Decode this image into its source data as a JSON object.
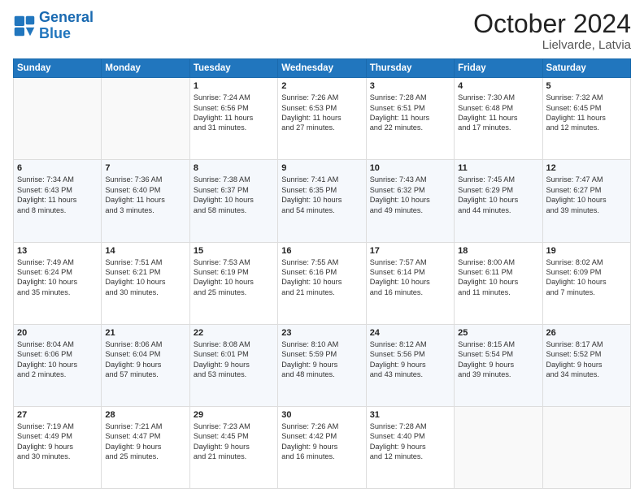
{
  "header": {
    "logo_general": "General",
    "logo_blue": "Blue",
    "month": "October 2024",
    "location": "Lielvarde, Latvia"
  },
  "days_of_week": [
    "Sunday",
    "Monday",
    "Tuesday",
    "Wednesday",
    "Thursday",
    "Friday",
    "Saturday"
  ],
  "weeks": [
    [
      {
        "day": "",
        "lines": []
      },
      {
        "day": "",
        "lines": []
      },
      {
        "day": "1",
        "lines": [
          "Sunrise: 7:24 AM",
          "Sunset: 6:56 PM",
          "Daylight: 11 hours",
          "and 31 minutes."
        ]
      },
      {
        "day": "2",
        "lines": [
          "Sunrise: 7:26 AM",
          "Sunset: 6:53 PM",
          "Daylight: 11 hours",
          "and 27 minutes."
        ]
      },
      {
        "day": "3",
        "lines": [
          "Sunrise: 7:28 AM",
          "Sunset: 6:51 PM",
          "Daylight: 11 hours",
          "and 22 minutes."
        ]
      },
      {
        "day": "4",
        "lines": [
          "Sunrise: 7:30 AM",
          "Sunset: 6:48 PM",
          "Daylight: 11 hours",
          "and 17 minutes."
        ]
      },
      {
        "day": "5",
        "lines": [
          "Sunrise: 7:32 AM",
          "Sunset: 6:45 PM",
          "Daylight: 11 hours",
          "and 12 minutes."
        ]
      }
    ],
    [
      {
        "day": "6",
        "lines": [
          "Sunrise: 7:34 AM",
          "Sunset: 6:43 PM",
          "Daylight: 11 hours",
          "and 8 minutes."
        ]
      },
      {
        "day": "7",
        "lines": [
          "Sunrise: 7:36 AM",
          "Sunset: 6:40 PM",
          "Daylight: 11 hours",
          "and 3 minutes."
        ]
      },
      {
        "day": "8",
        "lines": [
          "Sunrise: 7:38 AM",
          "Sunset: 6:37 PM",
          "Daylight: 10 hours",
          "and 58 minutes."
        ]
      },
      {
        "day": "9",
        "lines": [
          "Sunrise: 7:41 AM",
          "Sunset: 6:35 PM",
          "Daylight: 10 hours",
          "and 54 minutes."
        ]
      },
      {
        "day": "10",
        "lines": [
          "Sunrise: 7:43 AM",
          "Sunset: 6:32 PM",
          "Daylight: 10 hours",
          "and 49 minutes."
        ]
      },
      {
        "day": "11",
        "lines": [
          "Sunrise: 7:45 AM",
          "Sunset: 6:29 PM",
          "Daylight: 10 hours",
          "and 44 minutes."
        ]
      },
      {
        "day": "12",
        "lines": [
          "Sunrise: 7:47 AM",
          "Sunset: 6:27 PM",
          "Daylight: 10 hours",
          "and 39 minutes."
        ]
      }
    ],
    [
      {
        "day": "13",
        "lines": [
          "Sunrise: 7:49 AM",
          "Sunset: 6:24 PM",
          "Daylight: 10 hours",
          "and 35 minutes."
        ]
      },
      {
        "day": "14",
        "lines": [
          "Sunrise: 7:51 AM",
          "Sunset: 6:21 PM",
          "Daylight: 10 hours",
          "and 30 minutes."
        ]
      },
      {
        "day": "15",
        "lines": [
          "Sunrise: 7:53 AM",
          "Sunset: 6:19 PM",
          "Daylight: 10 hours",
          "and 25 minutes."
        ]
      },
      {
        "day": "16",
        "lines": [
          "Sunrise: 7:55 AM",
          "Sunset: 6:16 PM",
          "Daylight: 10 hours",
          "and 21 minutes."
        ]
      },
      {
        "day": "17",
        "lines": [
          "Sunrise: 7:57 AM",
          "Sunset: 6:14 PM",
          "Daylight: 10 hours",
          "and 16 minutes."
        ]
      },
      {
        "day": "18",
        "lines": [
          "Sunrise: 8:00 AM",
          "Sunset: 6:11 PM",
          "Daylight: 10 hours",
          "and 11 minutes."
        ]
      },
      {
        "day": "19",
        "lines": [
          "Sunrise: 8:02 AM",
          "Sunset: 6:09 PM",
          "Daylight: 10 hours",
          "and 7 minutes."
        ]
      }
    ],
    [
      {
        "day": "20",
        "lines": [
          "Sunrise: 8:04 AM",
          "Sunset: 6:06 PM",
          "Daylight: 10 hours",
          "and 2 minutes."
        ]
      },
      {
        "day": "21",
        "lines": [
          "Sunrise: 8:06 AM",
          "Sunset: 6:04 PM",
          "Daylight: 9 hours",
          "and 57 minutes."
        ]
      },
      {
        "day": "22",
        "lines": [
          "Sunrise: 8:08 AM",
          "Sunset: 6:01 PM",
          "Daylight: 9 hours",
          "and 53 minutes."
        ]
      },
      {
        "day": "23",
        "lines": [
          "Sunrise: 8:10 AM",
          "Sunset: 5:59 PM",
          "Daylight: 9 hours",
          "and 48 minutes."
        ]
      },
      {
        "day": "24",
        "lines": [
          "Sunrise: 8:12 AM",
          "Sunset: 5:56 PM",
          "Daylight: 9 hours",
          "and 43 minutes."
        ]
      },
      {
        "day": "25",
        "lines": [
          "Sunrise: 8:15 AM",
          "Sunset: 5:54 PM",
          "Daylight: 9 hours",
          "and 39 minutes."
        ]
      },
      {
        "day": "26",
        "lines": [
          "Sunrise: 8:17 AM",
          "Sunset: 5:52 PM",
          "Daylight: 9 hours",
          "and 34 minutes."
        ]
      }
    ],
    [
      {
        "day": "27",
        "lines": [
          "Sunrise: 7:19 AM",
          "Sunset: 4:49 PM",
          "Daylight: 9 hours",
          "and 30 minutes."
        ]
      },
      {
        "day": "28",
        "lines": [
          "Sunrise: 7:21 AM",
          "Sunset: 4:47 PM",
          "Daylight: 9 hours",
          "and 25 minutes."
        ]
      },
      {
        "day": "29",
        "lines": [
          "Sunrise: 7:23 AM",
          "Sunset: 4:45 PM",
          "Daylight: 9 hours",
          "and 21 minutes."
        ]
      },
      {
        "day": "30",
        "lines": [
          "Sunrise: 7:26 AM",
          "Sunset: 4:42 PM",
          "Daylight: 9 hours",
          "and 16 minutes."
        ]
      },
      {
        "day": "31",
        "lines": [
          "Sunrise: 7:28 AM",
          "Sunset: 4:40 PM",
          "Daylight: 9 hours",
          "and 12 minutes."
        ]
      },
      {
        "day": "",
        "lines": []
      },
      {
        "day": "",
        "lines": []
      }
    ]
  ]
}
